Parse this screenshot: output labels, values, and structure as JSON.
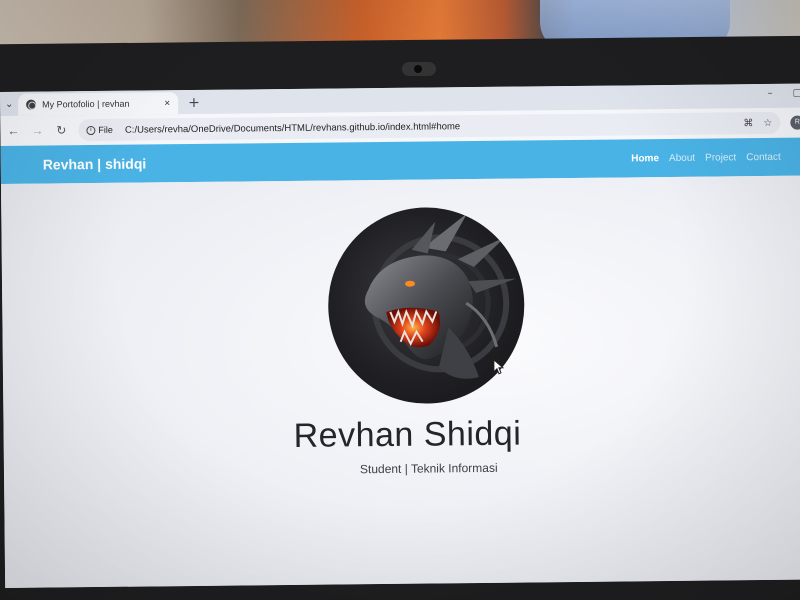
{
  "browser": {
    "tab_title": "My Portofolio | revhan",
    "tab_close": "×",
    "new_tab": "+",
    "minimize": "–",
    "restore": "▢",
    "chip_label": "File",
    "url": "C:/Users/revha/OneDrive/Documents/HTML/revhans.github.io/index.html#home",
    "profile_initial": "R"
  },
  "navbar": {
    "brand": "Revhan | shidqi",
    "links": [
      {
        "label": "Home",
        "active": true
      },
      {
        "label": "About",
        "active": false
      },
      {
        "label": "Project",
        "active": false
      },
      {
        "label": "Contact",
        "active": false
      }
    ]
  },
  "hero": {
    "name": "Revhan Shidqi",
    "subtitle": "Student | Teknik Informasi",
    "avatar_icon": "dragon-icon"
  },
  "colors": {
    "navbar": "#4ab3e6",
    "page_bg": "#f0f1f6",
    "text_dark": "#23252b"
  }
}
